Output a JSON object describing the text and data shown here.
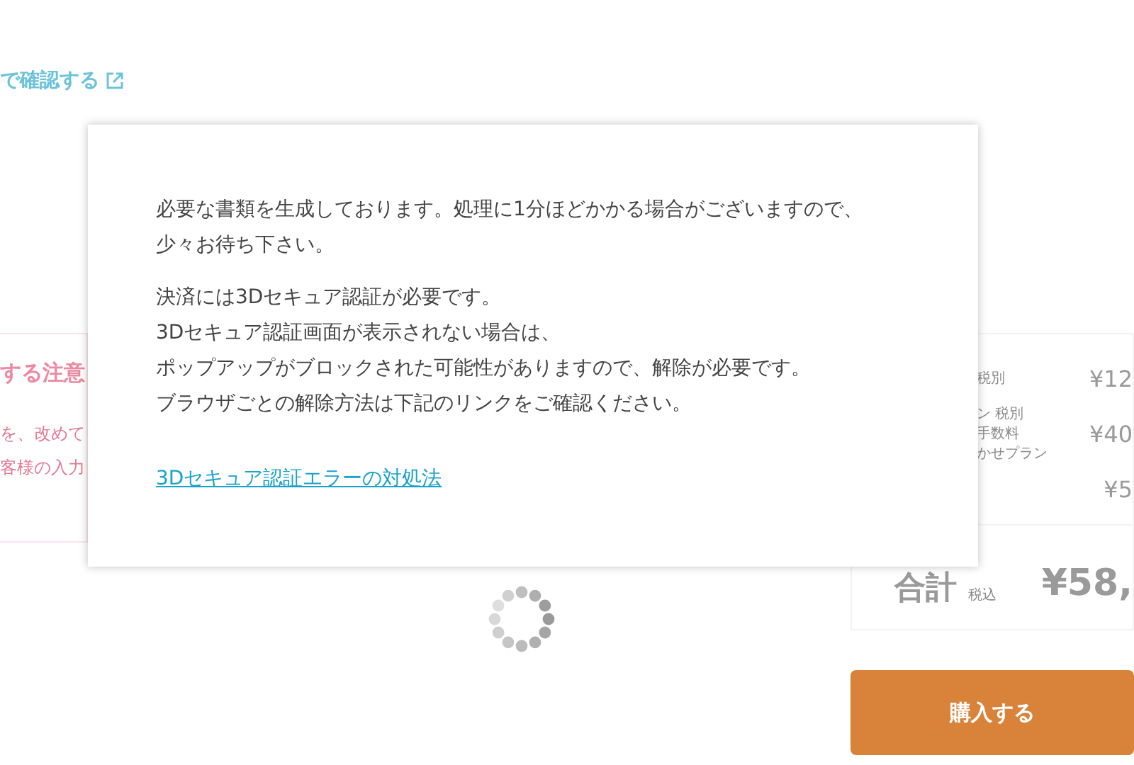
{
  "page": {
    "confirm_link": "で確認する",
    "notice": {
      "title": "する注意",
      "lines": [
        "を、改めて",
        "客様の入力"
      ]
    },
    "summary": {
      "rows": [
        {
          "labels": [
            "税別"
          ],
          "price": "¥12"
        },
        {
          "labels": [
            "ン 税別",
            "手数料",
            "かせプラン"
          ],
          "price": "¥40"
        },
        {
          "labels": [],
          "price": "¥5"
        }
      ],
      "total_label": "合計",
      "tax_note": "税込",
      "total": "¥58,"
    },
    "purchase_button": "購入する"
  },
  "dialog": {
    "paragraphs": [
      [
        "必要な書類を生成しております。処理に1分ほどかかる場合がございますので、少々お待ち下さい。"
      ],
      [
        "決済には3Dセキュア認証が必要です。",
        "3Dセキュア認証画面が表示されない場合は、",
        "ポップアップがブロックされた可能性がありますので、解除が必要です。",
        "ブラウザごとの解除方法は下記のリンクをご確認ください。"
      ]
    ],
    "link": "3Dセキュア認証エラーの対処法"
  }
}
